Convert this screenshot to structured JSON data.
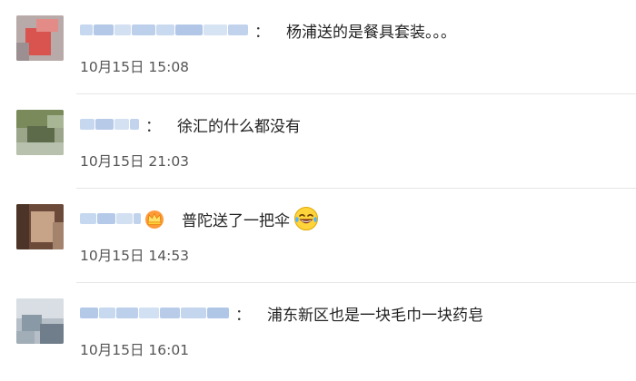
{
  "comments": [
    {
      "name_obscured": true,
      "text": "杨浦送的是餐具套装。。。",
      "time": "10月15日 15:08",
      "avatar_color": "#d9534f"
    },
    {
      "name_obscured": true,
      "text": "徐汇的什么都没有",
      "time": "10月15日 21:03",
      "avatar_color": "#7a8a5a"
    },
    {
      "name_obscured": true,
      "text": "普陀送了一把伞",
      "time": "10月15日 14:53",
      "avatar_color": "#6b4a3a",
      "badge_icon": "crown-icon",
      "trailing_emoji": "laughing-tears-emoji"
    },
    {
      "name_obscured": true,
      "text": "浦东新区也是一块毛巾一块药皂",
      "time": "10月15日 16:01",
      "avatar_color": "#8a99a6"
    }
  ],
  "colors": {
    "name_blur": "#b7cdea",
    "divider": "#e6e6e6",
    "text": "#222222",
    "time": "#555555"
  }
}
